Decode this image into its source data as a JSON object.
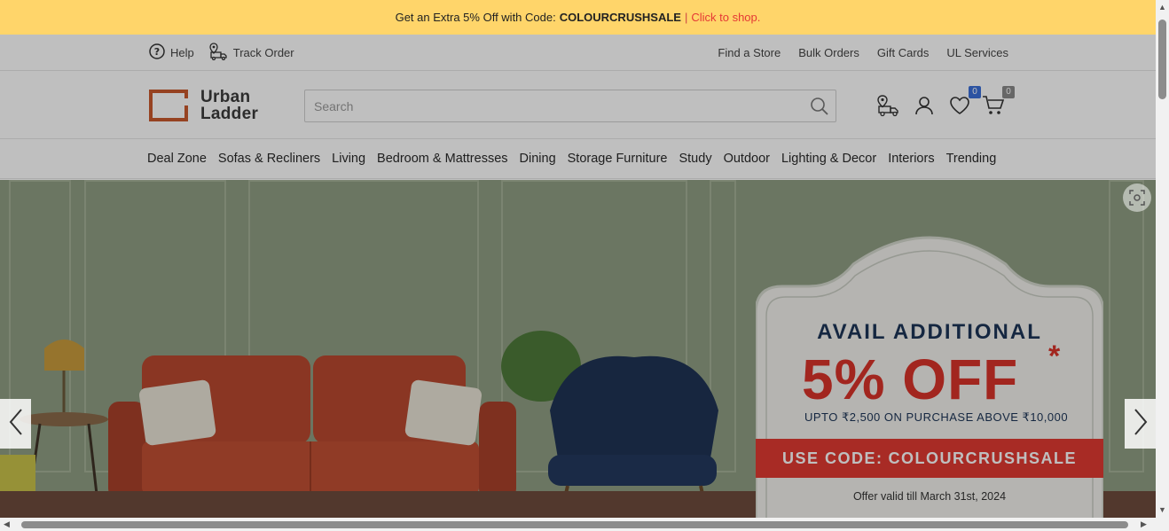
{
  "promo": {
    "text": "Get an Extra 5% Off with Code:",
    "code": "COLOURCRUSHSALE",
    "separator": "|",
    "cta": "Click to shop."
  },
  "utility": {
    "help": "Help",
    "track_order": "Track Order",
    "links": [
      "Find a Store",
      "Bulk Orders",
      "Gift Cards",
      "UL Services"
    ]
  },
  "logo": {
    "line1": "Urban",
    "line2": "Ladder"
  },
  "search": {
    "placeholder": "Search",
    "value": ""
  },
  "header_icons": {
    "wishlist_count": "0",
    "cart_count": "0",
    "badge_colors": {
      "wishlist": "#3b6fd8",
      "cart": "#8a8a8a"
    }
  },
  "categories": [
    "Deal Zone",
    "Sofas & Recliners",
    "Living",
    "Bedroom & Mattresses",
    "Dining",
    "Storage Furniture",
    "Study",
    "Outdoor",
    "Lighting & Decor",
    "Interiors",
    "Trending"
  ],
  "hero": {
    "line1": "AVAIL ADDITIONAL",
    "big": "5% OFF",
    "star": "*",
    "upto": "UPTO ₹2,500 ON PURCHASE ABOVE ₹10,000",
    "code_label": "USE CODE:",
    "code": "COLOURCRUSHSALE",
    "valid": "Offer valid till March 31st, 2024"
  },
  "colors": {
    "promo_bg": "#ffd56a",
    "accent_red": "#e03a32",
    "brand_orange": "#c8592c",
    "navy": "#1d3557"
  }
}
